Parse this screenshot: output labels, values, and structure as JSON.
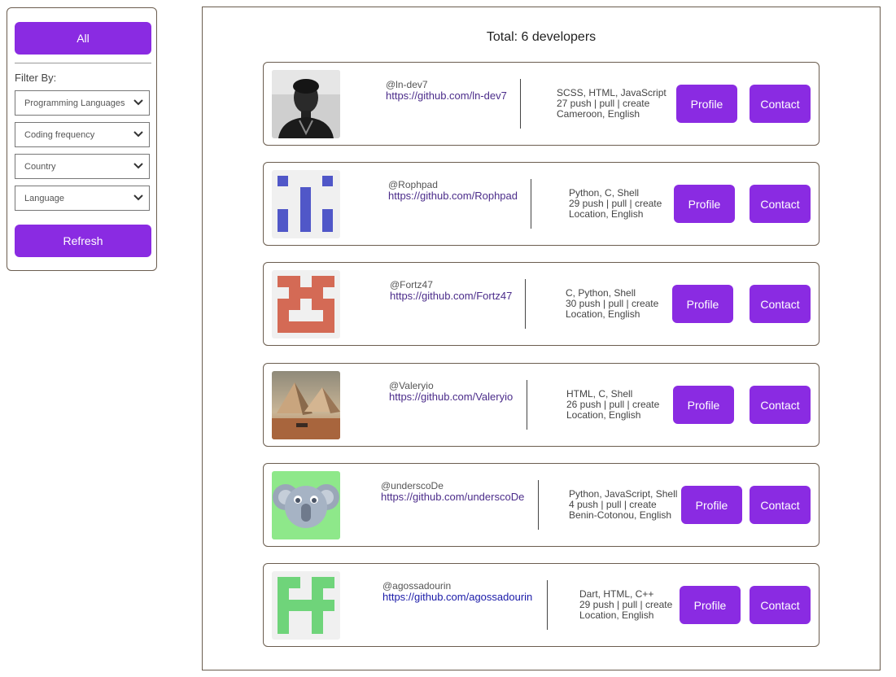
{
  "sidebar": {
    "all_label": "All",
    "filter_label": "Filter By:",
    "selects": [
      {
        "value": "Programming Languages"
      },
      {
        "value": "Coding frequency"
      },
      {
        "value": "Country"
      },
      {
        "value": "Language"
      }
    ],
    "refresh_label": "Refresh"
  },
  "main": {
    "total_text": "Total: 6 developers",
    "developers": [
      {
        "handle": "@ln-dev7",
        "url": "https://github.com/ln-dev7",
        "languages": "SCSS, HTML, JavaScript",
        "activity": "27 push | pull | create",
        "location": "Cameroon, English",
        "profile_label": "Profile",
        "contact_label": "Contact"
      },
      {
        "handle": "@Rophpad",
        "url": "https://github.com/Rophpad",
        "languages": "Python, C, Shell",
        "activity": "29 push | pull | create",
        "location": "Location, English",
        "profile_label": "Profile",
        "contact_label": "Contact"
      },
      {
        "handle": "@Fortz47",
        "url": "https://github.com/Fortz47",
        "languages": "C, Python, Shell",
        "activity": "30 push | pull | create",
        "location": "Location, English",
        "profile_label": "Profile",
        "contact_label": "Contact"
      },
      {
        "handle": "@Valeryio",
        "url": "https://github.com/Valeryio",
        "languages": "HTML, C, Shell",
        "activity": "26 push | pull | create",
        "location": "Location, English",
        "profile_label": "Profile",
        "contact_label": "Contact"
      },
      {
        "handle": "@underscoDe",
        "url": "https://github.com/underscoDe",
        "languages": "Python, JavaScript, Shell",
        "activity": "4 push | pull | create",
        "location": "Benin-Cotonou, English",
        "profile_label": "Profile",
        "contact_label": "Contact"
      },
      {
        "handle": "@agossadourin",
        "url": "https://github.com/agossadourin",
        "languages": "Dart, HTML, C++",
        "activity": "29 push | pull | create",
        "location": "Location, English",
        "profile_label": "Profile",
        "contact_label": "Contact"
      }
    ]
  },
  "colors": {
    "accent": "#8a2be2",
    "border": "#6b5d4f",
    "link": "#4b2c8a"
  },
  "icons": {
    "select_chevron": "chevron-down-icon"
  }
}
